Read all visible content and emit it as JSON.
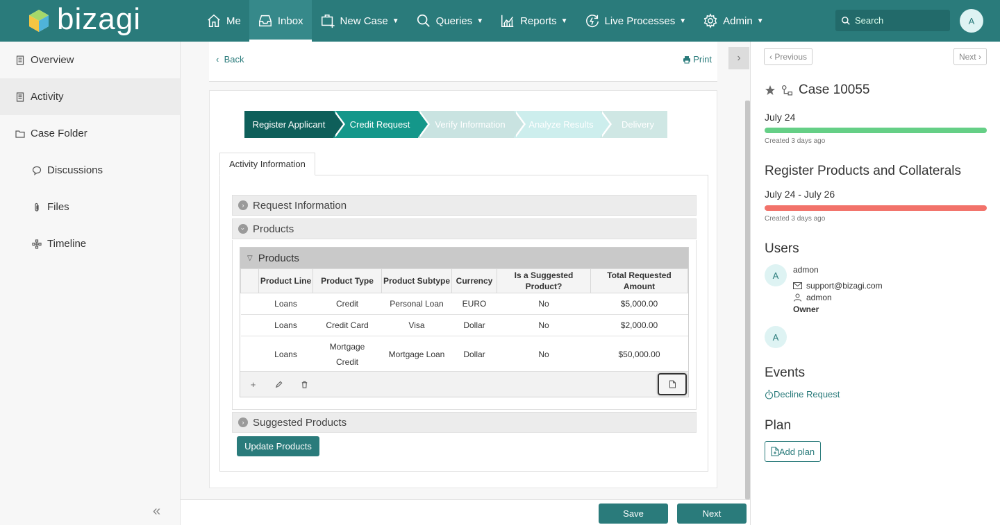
{
  "brand": {
    "name": "bizagi"
  },
  "nav": [
    {
      "label": "Me",
      "icon": "home-icon",
      "caret": false
    },
    {
      "label": "Inbox",
      "icon": "inbox-icon",
      "caret": false,
      "active": true
    },
    {
      "label": "New Case",
      "icon": "new-case-icon",
      "caret": true
    },
    {
      "label": "Queries",
      "icon": "search-icon",
      "caret": true
    },
    {
      "label": "Reports",
      "icon": "reports-icon",
      "caret": true
    },
    {
      "label": "Live Processes",
      "icon": "live-process-icon",
      "caret": true
    },
    {
      "label": "Admin",
      "icon": "gear-icon",
      "caret": true
    }
  ],
  "search": {
    "placeholder": "Search"
  },
  "user": {
    "initial": "A"
  },
  "sidebar": {
    "items": [
      {
        "label": "Overview"
      },
      {
        "label": "Activity"
      },
      {
        "label": "Case Folder"
      },
      {
        "label": "Discussions"
      },
      {
        "label": "Files"
      },
      {
        "label": "Timeline"
      }
    ]
  },
  "main": {
    "back": "Back",
    "print": "Print",
    "steps": [
      "Register Applicant",
      "Credit Request",
      "Verify Information",
      "Analyze Results",
      "Delivery"
    ],
    "tab": "Activity Information",
    "sections": {
      "request_info": "Request Information",
      "products": "Products",
      "suggested": "Suggested Products"
    },
    "grid": {
      "title": "Products",
      "columns": [
        "Product Line",
        "Product Type",
        "Product Subtype",
        "Currency",
        "Is a Suggested Product?",
        "Total Requested Amount"
      ],
      "rows": [
        [
          "Loans",
          "Credit",
          "Personal Loan",
          "EURO",
          "No",
          "$5,000.00"
        ],
        [
          "Loans",
          "Credit Card",
          "Visa",
          "Dollar",
          "No",
          "$2,000.00"
        ],
        [
          "Loans",
          "Mortgage Credit",
          "Mortgage Loan",
          "Dollar",
          "No",
          "$50,000.00"
        ]
      ]
    },
    "update_button": "Update Products"
  },
  "actions": {
    "save": "Save",
    "next": "Next"
  },
  "right": {
    "previous": "Previous",
    "next": "Next",
    "case_title": "Case 10055",
    "case_date": "July 24",
    "case_created": "Created 3 days ago",
    "task_title": "Register Products and Collaterals",
    "task_dates": "July 24 - July 26",
    "task_created": "Created 3 days ago",
    "users_heading": "Users",
    "user1": {
      "initial": "A",
      "name": "admon",
      "email": "support@bizagi.com",
      "login": "admon",
      "role": "Owner"
    },
    "user2": {
      "initial": "A"
    },
    "events_heading": "Events",
    "event": "Decline Request",
    "plan_heading": "Plan",
    "add_plan": "Add plan",
    "colors": {
      "case_bar": "#65cf86",
      "task_bar": "#f2726a"
    }
  }
}
